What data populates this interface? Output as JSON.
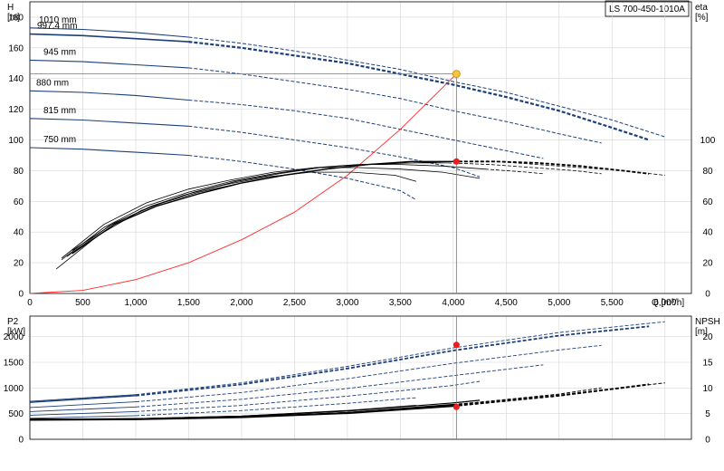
{
  "model_label": "LS 700-450-1010A",
  "top_chart": {
    "y_left_label": [
      "H",
      "[m]"
    ],
    "y_right_label": [
      "eta",
      "[%]"
    ],
    "x_label": "Q [m³/h]",
    "x_ticks": [
      "0",
      "500",
      "1,000",
      "1,500",
      "2,000",
      "2,500",
      "3,000",
      "3,500",
      "4,000",
      "4,500",
      "5,000",
      "5,500",
      "6,000"
    ],
    "x_range": [
      0,
      6250
    ],
    "y_left_ticks": [
      "0",
      "20",
      "40",
      "60",
      "80",
      "100",
      "120",
      "140",
      "160",
      "180"
    ],
    "y_left_range": [
      0,
      190
    ],
    "y_right_ticks": [
      "0",
      "20",
      "40",
      "60",
      "80",
      "100"
    ],
    "y_right_range": [
      0,
      190
    ]
  },
  "bottom_chart": {
    "y_left_label": [
      "P2",
      "[kW]"
    ],
    "y_right_label": [
      "NPSH",
      "[m]"
    ],
    "y_left_ticks": [
      "0",
      "500",
      "1000",
      "1500",
      "2000"
    ],
    "y_left_range": [
      0,
      2400
    ],
    "y_right_ticks": [
      "0",
      "5",
      "10",
      "15",
      "20"
    ],
    "y_right_range": [
      0,
      24
    ],
    "x_range": [
      0,
      6250
    ]
  },
  "chart_data": [
    {
      "type": "line",
      "title": "",
      "xlabel": "Q [m³/h]",
      "ylabel": "H [m]",
      "y2label": "eta [%]",
      "xlim": [
        0,
        6250
      ],
      "ylim": [
        0,
        190
      ],
      "grid": true,
      "series": [
        {
          "name": "1010 mm",
          "kind": "head",
          "label": true,
          "x": [
            0,
            500,
            1000,
            1500,
            2000,
            2500,
            3000,
            3500,
            4000,
            4500,
            5000,
            5500,
            6000
          ],
          "y": [
            173,
            172,
            170,
            167,
            163,
            158,
            152,
            146,
            138,
            131,
            122,
            113,
            102
          ]
        },
        {
          "name": "997.4 mm",
          "kind": "head",
          "label": true,
          "bold": true,
          "x": [
            0,
            500,
            1000,
            1500,
            2000,
            2500,
            3000,
            3500,
            4000,
            4500,
            5000,
            5500,
            5850
          ],
          "y": [
            169,
            168,
            166,
            164,
            160,
            155,
            150,
            143,
            136,
            128,
            119,
            108,
            100
          ]
        },
        {
          "name": "945 mm",
          "kind": "head",
          "label": true,
          "x": [
            0,
            500,
            1000,
            1500,
            2000,
            2500,
            3000,
            3500,
            4000,
            4500,
            5000,
            5400
          ],
          "y": [
            152,
            151,
            149,
            147,
            143,
            138,
            133,
            127,
            119,
            112,
            104,
            98
          ]
        },
        {
          "name": "880 mm",
          "kind": "head",
          "label": true,
          "x": [
            0,
            500,
            1000,
            1500,
            2000,
            2500,
            3000,
            3500,
            4000,
            4500,
            4850
          ],
          "y": [
            132,
            131,
            129,
            126,
            123,
            119,
            114,
            107,
            100,
            93,
            88
          ]
        },
        {
          "name": "815 mm",
          "kind": "head",
          "label": true,
          "x": [
            0,
            500,
            1000,
            1500,
            2000,
            2500,
            3000,
            3500,
            4000,
            4250
          ],
          "y": [
            114,
            113,
            111,
            109,
            105,
            100,
            95,
            89,
            82,
            76
          ]
        },
        {
          "name": "750 mm",
          "kind": "head",
          "label": true,
          "x": [
            0,
            500,
            1000,
            1500,
            2000,
            2500,
            3000,
            3500,
            3650
          ],
          "y": [
            95,
            94,
            92,
            90,
            86,
            81,
            75,
            67,
            61
          ]
        },
        {
          "name": "system",
          "kind": "system",
          "label": false,
          "color": "#ff2a2a",
          "x": [
            0,
            500,
            1000,
            1500,
            2000,
            2500,
            3000,
            3500,
            4030
          ],
          "y": [
            0,
            2,
            9,
            20,
            35,
            53,
            77,
            107,
            143
          ]
        },
        {
          "name": "eta 1010",
          "kind": "eta",
          "label": false,
          "x": [
            400,
            800,
            1200,
            1600,
            2000,
            2400,
            2800,
            3200,
            3600,
            4000,
            4400,
            4800,
            5200,
            5600,
            6000
          ],
          "y": [
            28,
            46,
            58,
            66,
            72,
            77,
            81,
            84,
            85,
            86,
            86,
            84,
            82,
            80,
            77
          ]
        },
        {
          "name": "eta 997.4",
          "kind": "eta",
          "label": false,
          "x": [
            400,
            800,
            1200,
            1600,
            2000,
            2400,
            2800,
            3200,
            3600,
            4000,
            4400,
            4800,
            5200,
            5600,
            5850
          ],
          "y": [
            26,
            45,
            57,
            65,
            72,
            77,
            81,
            84,
            86,
            86,
            86,
            85,
            83,
            80,
            78
          ]
        },
        {
          "name": "eta 945",
          "kind": "eta",
          "label": false,
          "x": [
            350,
            750,
            1150,
            1550,
            1950,
            2350,
            2750,
            3150,
            3550,
            3950,
            4350,
            4750,
            5150,
            5400
          ],
          "y": [
            24,
            44,
            57,
            66,
            73,
            78,
            82,
            84,
            85,
            85,
            84,
            82,
            80,
            78
          ]
        },
        {
          "name": "eta 880",
          "kind": "eta",
          "label": false,
          "x": [
            300,
            700,
            1100,
            1500,
            1900,
            2300,
            2700,
            3100,
            3500,
            3900,
            4300,
            4700,
            4850
          ],
          "y": [
            22,
            43,
            57,
            66,
            73,
            78,
            82,
            84,
            84,
            83,
            81,
            79,
            78
          ]
        },
        {
          "name": "eta 815",
          "kind": "eta",
          "label": false,
          "x": [
            300,
            700,
            1100,
            1500,
            1900,
            2300,
            2700,
            3100,
            3500,
            3900,
            4250
          ],
          "y": [
            23,
            45,
            59,
            68,
            74,
            79,
            82,
            82,
            81,
            79,
            75
          ]
        },
        {
          "name": "eta 750",
          "kind": "eta",
          "label": false,
          "x": [
            250,
            650,
            1050,
            1450,
            1850,
            2250,
            2650,
            3050,
            3450,
            3650
          ],
          "y": [
            16,
            38,
            54,
            64,
            71,
            76,
            79,
            79,
            77,
            73
          ]
        }
      ],
      "duty_point": {
        "x": 4030,
        "y": 143,
        "eta": 86
      }
    },
    {
      "type": "line",
      "title": "",
      "xlabel": "",
      "ylabel": "P2 [kW]",
      "y2label": "NPSH [m]",
      "xlim": [
        0,
        6250
      ],
      "ylim": [
        0,
        2400
      ],
      "grid": true,
      "series": [
        {
          "name": "P2 1010",
          "kind": "power",
          "x": [
            0,
            1000,
            2000,
            3000,
            4000,
            5000,
            6000
          ],
          "y": [
            740,
            870,
            1100,
            1420,
            1780,
            2080,
            2290
          ]
        },
        {
          "name": "P2 997.4",
          "kind": "power",
          "bold": true,
          "x": [
            0,
            1000,
            2000,
            3000,
            4000,
            5000,
            5850
          ],
          "y": [
            720,
            850,
            1070,
            1380,
            1730,
            2020,
            2200
          ]
        },
        {
          "name": "P2 945",
          "kind": "power",
          "x": [
            0,
            1000,
            2000,
            3000,
            4000,
            5000,
            5400
          ],
          "y": [
            620,
            730,
            910,
            1180,
            1480,
            1740,
            1830
          ]
        },
        {
          "name": "P2 880",
          "kind": "power",
          "x": [
            0,
            1000,
            2000,
            3000,
            4000,
            4850
          ],
          "y": [
            540,
            630,
            780,
            990,
            1240,
            1450
          ]
        },
        {
          "name": "P2 815",
          "kind": "power",
          "x": [
            0,
            1000,
            2000,
            3000,
            4000,
            4250
          ],
          "y": [
            470,
            540,
            660,
            840,
            1050,
            1130
          ]
        },
        {
          "name": "P2 750",
          "kind": "power",
          "x": [
            0,
            1000,
            2000,
            3000,
            3650
          ],
          "y": [
            410,
            460,
            560,
            700,
            810
          ]
        },
        {
          "name": "NPSH 1010",
          "kind": "npsh",
          "x": [
            0,
            1000,
            2000,
            3000,
            4000,
            5000,
            6000
          ],
          "y": [
            3.9,
            4.0,
            4.4,
            5.1,
            6.5,
            8.6,
            11.0
          ]
        },
        {
          "name": "NPSH 997.4",
          "kind": "npsh",
          "bold": true,
          "x": [
            0,
            1000,
            2000,
            3000,
            4000,
            5000,
            5850
          ],
          "y": [
            3.8,
            3.9,
            4.3,
            5.1,
            6.5,
            8.5,
            10.7
          ]
        },
        {
          "name": "NPSH 945",
          "kind": "npsh",
          "x": [
            0,
            1000,
            2000,
            3000,
            4000,
            5000,
            5400
          ],
          "y": [
            3.8,
            3.9,
            4.3,
            5.2,
            6.7,
            8.8,
            10.0
          ]
        },
        {
          "name": "NPSH 880",
          "kind": "npsh",
          "x": [
            0,
            1000,
            2000,
            3000,
            4000,
            4850
          ],
          "y": [
            3.8,
            3.9,
            4.3,
            5.2,
            6.8,
            8.3
          ]
        },
        {
          "name": "NPSH 815",
          "kind": "npsh",
          "x": [
            0,
            1000,
            2000,
            3000,
            4000,
            4250
          ],
          "y": [
            3.9,
            4.0,
            4.5,
            5.5,
            7.1,
            7.6
          ]
        },
        {
          "name": "NPSH 750",
          "kind": "npsh",
          "x": [
            0,
            1000,
            2000,
            3000,
            3650
          ],
          "y": [
            3.9,
            4.0,
            4.5,
            5.6,
            6.6
          ]
        }
      ],
      "duty_point": {
        "x": 4030,
        "p2": 1840,
        "npsh": 6.3
      }
    }
  ],
  "colors": {
    "head_line": "#1c3f7a",
    "eta_line": "#000000",
    "system_curve": "#ff2a2a",
    "duty_marker": "#f5c342",
    "duty_point_red": "#ee1c1c",
    "grid": "#d6d6d6"
  }
}
